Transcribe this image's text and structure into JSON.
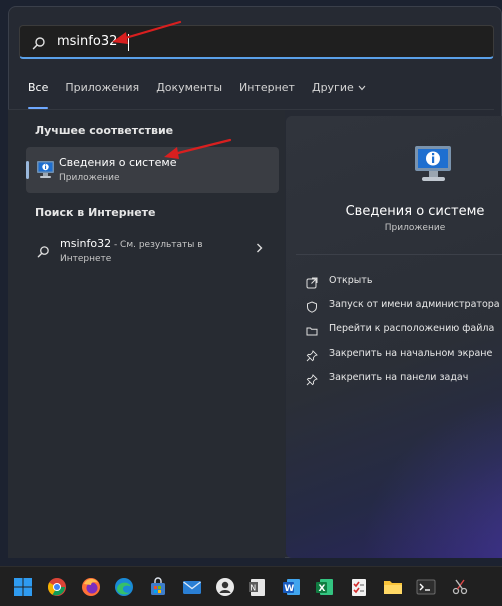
{
  "search": {
    "query": "msinfo32"
  },
  "tabs": [
    {
      "label": "Все",
      "active": true
    },
    {
      "label": "Приложения"
    },
    {
      "label": "Документы"
    },
    {
      "label": "Интернет"
    },
    {
      "label": "Другие"
    }
  ],
  "tabs_more_icon": "chevron-down-icon",
  "best_match": {
    "section_title": "Лучшее соответствие",
    "name": "Сведения о системе",
    "type": "Приложение",
    "icon": "system-information-icon"
  },
  "web": {
    "section_title": "Поиск в Интернете",
    "query": "msinfo32",
    "suffix": " - См. результаты в",
    "line2": "Интернете",
    "icon": "search-icon"
  },
  "details": {
    "title": "Сведения о системе",
    "subtitle": "Приложение",
    "actions": [
      {
        "label": "Открыть",
        "icon": "open-external-icon"
      },
      {
        "label": "Запуск от имени администратора",
        "icon": "shield-admin-icon"
      },
      {
        "label": "Перейти к расположению файла",
        "icon": "folder-icon"
      },
      {
        "label": "Закрепить на начальном экране",
        "icon": "pin-icon"
      },
      {
        "label": "Закрепить на панели задач",
        "icon": "pin-icon"
      }
    ]
  },
  "taskbar": {
    "icons": [
      "start-icon",
      "chrome-icon",
      "firefox-icon",
      "edge-icon",
      "store-bag-icon",
      "mail-icon",
      "user-tool-icon",
      "notepad-icon",
      "word-icon",
      "excel-icon",
      "checklist-icon",
      "file-explorer-icon",
      "terminal-icon",
      "snipping-icon"
    ]
  },
  "colors": {
    "accent": "#6ea8ff",
    "arrow": "#d81f1f",
    "panel": "#262a33",
    "taskbar": "#202020"
  }
}
